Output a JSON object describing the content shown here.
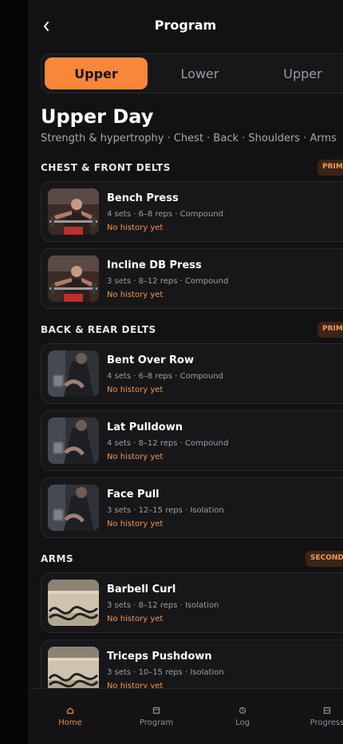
{
  "header": {
    "title": "Program"
  },
  "tabs": [
    {
      "label": "Upper",
      "active": true
    },
    {
      "label": "Lower",
      "active": false
    },
    {
      "label": "Upper",
      "active": false
    }
  ],
  "day": {
    "title": "Upper Day",
    "subtitle": "Strength & hypertrophy · Chest · Back · Shoulders · Arms"
  },
  "sections": [
    {
      "title": "CHEST & FRONT DELTS",
      "badge": "PRIMARY",
      "exercises": [
        {
          "name": "Bench Press",
          "meta": "4 sets · 6–8 reps · Compound",
          "history": "No history yet",
          "thumb": "press"
        },
        {
          "name": "Incline DB Press",
          "meta": "3 sets · 8–12 reps · Compound",
          "history": "No history yet",
          "thumb": "press"
        }
      ]
    },
    {
      "title": "BACK & REAR DELTS",
      "badge": "PRIMARY",
      "exercises": [
        {
          "name": "Bent Over Row",
          "meta": "4 sets · 6–8 reps · Compound",
          "history": "No history yet",
          "thumb": "row"
        },
        {
          "name": "Lat Pulldown",
          "meta": "4 sets · 8–12 reps · Compound",
          "history": "No history yet",
          "thumb": "row"
        },
        {
          "name": "Face Pull",
          "meta": "3 sets · 12–15 reps · Isolation",
          "history": "No history yet",
          "thumb": "row"
        }
      ]
    },
    {
      "title": "ARMS",
      "badge": "SECONDARY",
      "exercises": [
        {
          "name": "Barbell Curl",
          "meta": "3 sets · 8–12 reps · Isolation",
          "history": "No history yet",
          "thumb": "ropes"
        },
        {
          "name": "Triceps Pushdown",
          "meta": "3 sets · 10–15 reps · Isolation",
          "history": "No history yet",
          "thumb": "ropes"
        }
      ]
    }
  ],
  "nav": [
    {
      "label": "Home",
      "icon": "home-icon",
      "active": true
    },
    {
      "label": "Program",
      "icon": "program-icon",
      "active": false
    },
    {
      "label": "Log",
      "icon": "log-icon",
      "active": false
    },
    {
      "label": "Progress",
      "icon": "progress-icon",
      "active": false
    }
  ],
  "colors": {
    "accent": "#f7873a",
    "background": "#121214",
    "card": "#17171a",
    "badge_bg": "#3a2415"
  }
}
